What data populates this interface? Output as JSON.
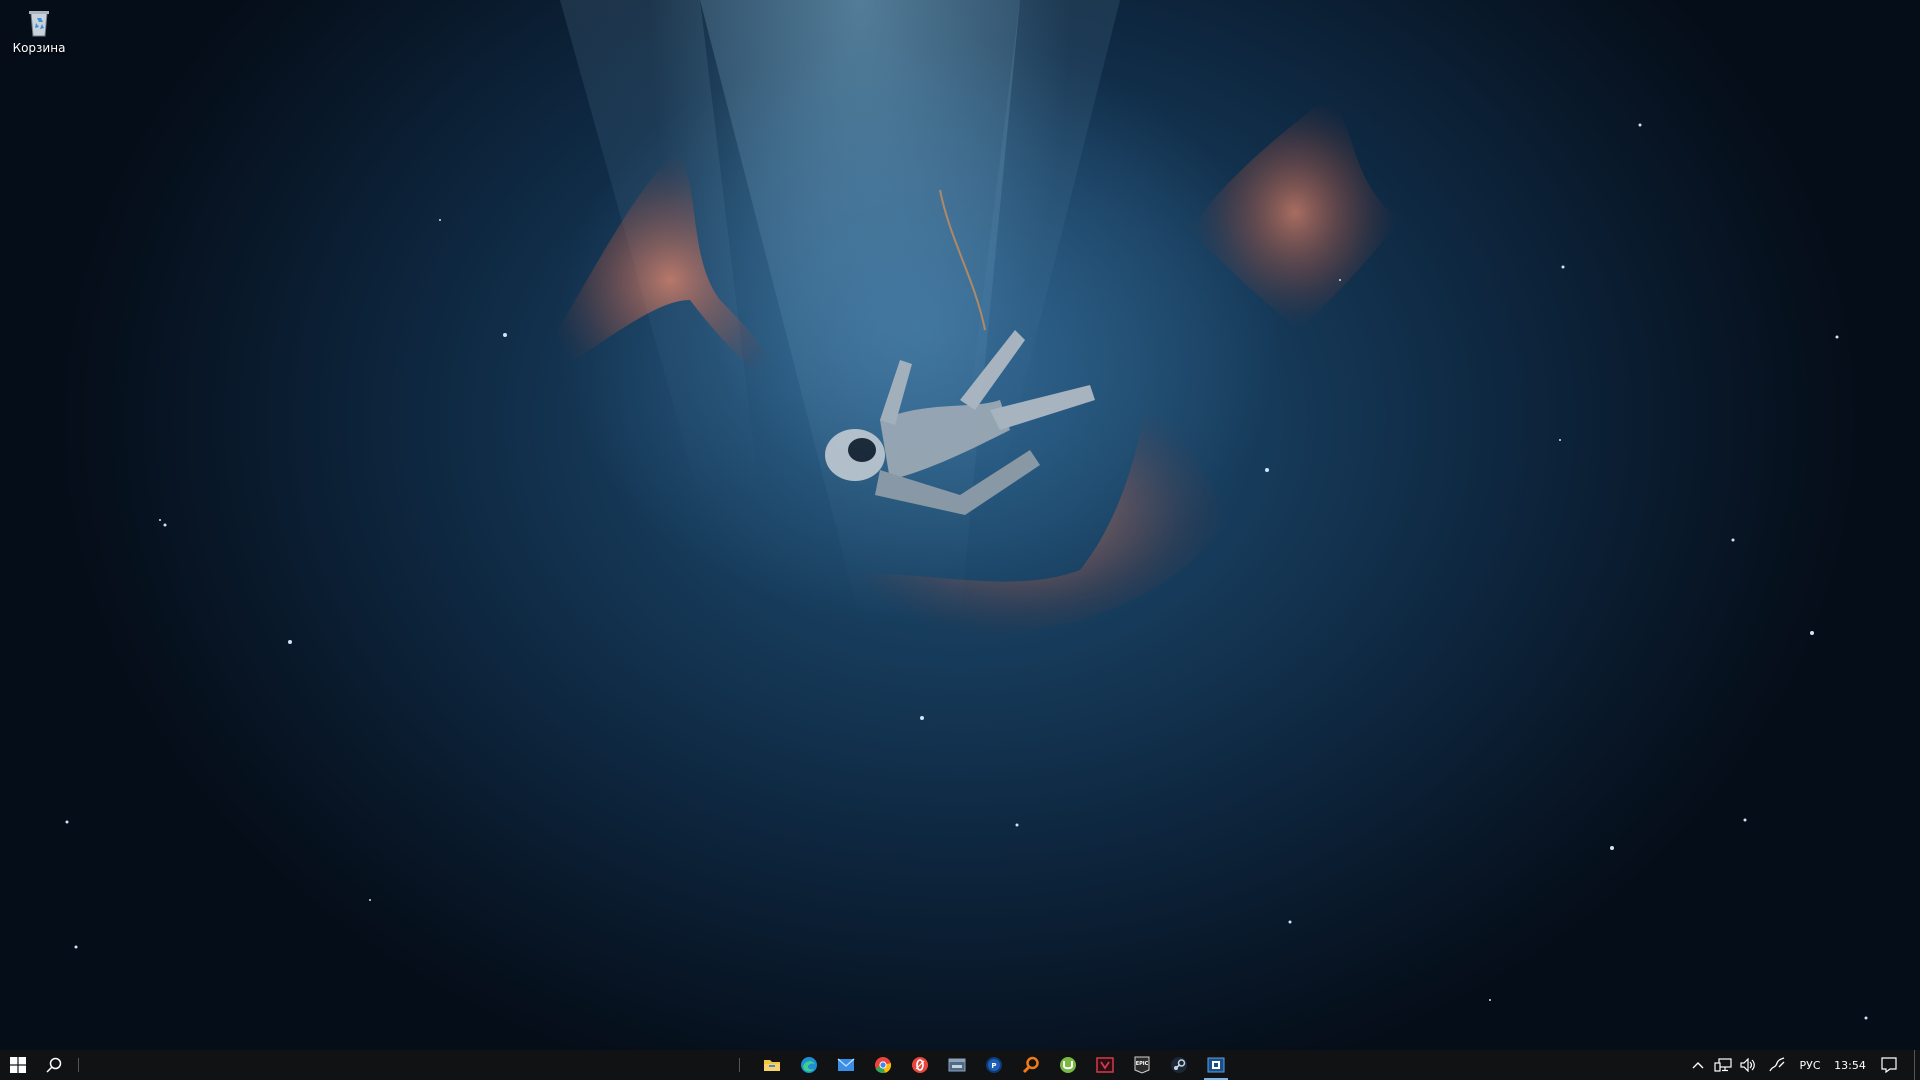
{
  "desktop": {
    "icons": [
      {
        "label": "Корзина",
        "icon": "recycle-bin-icon"
      }
    ]
  },
  "taskbar": {
    "start_icon": "windows-start-icon",
    "search_icon": "search-icon",
    "apps": [
      {
        "icon": "file-explorer-icon",
        "color": "#f4c542"
      },
      {
        "icon": "edge-icon",
        "color": "#2fb3a8"
      },
      {
        "icon": "mail-icon",
        "color": "#3a8ee6"
      },
      {
        "icon": "chrome-icon",
        "color": "#e8453c"
      },
      {
        "icon": "opera-gx-icon",
        "color": "#e8453c"
      },
      {
        "icon": "window-app-icon",
        "color": "#8fa3b8"
      },
      {
        "icon": "ps-app-icon",
        "color": "#1e5fb5"
      },
      {
        "icon": "search-app-icon",
        "color": "#f07a1a"
      },
      {
        "icon": "utorrent-icon",
        "color": "#78b843"
      },
      {
        "icon": "vegas-app-icon",
        "color": "#d33a4b"
      },
      {
        "icon": "epic-games-icon",
        "color": "#d0d0d0"
      },
      {
        "icon": "steam-icon",
        "color": "#c7d5e0"
      },
      {
        "icon": "active-app-icon",
        "color": "#5aa0e6"
      }
    ],
    "tray": {
      "chevron_icon": "chevron-up-icon",
      "network_icon": "network-icon",
      "volume_icon": "volume-icon",
      "pen_icon": "pen-icon",
      "language": "РУС",
      "time": "13:54",
      "notification_icon": "notification-icon"
    }
  }
}
